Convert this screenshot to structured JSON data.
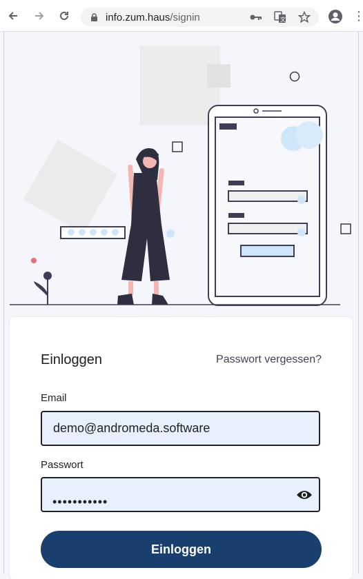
{
  "browser": {
    "url_host": "info.zum.haus",
    "url_path": "/signin",
    "back_icon": "arrow-left-icon",
    "forward_icon": "arrow-right-icon",
    "reload_icon": "reload-icon",
    "lock_icon": "lock-icon",
    "key_icon": "key-icon",
    "translate_icon": "translate-icon",
    "star_icon": "star-icon",
    "profile_icon": "profile-icon",
    "menu_icon": "kebab-menu-icon"
  },
  "login": {
    "title": "Einloggen",
    "forgot_label": "Passwort vergessen?",
    "email_label": "Email",
    "email_value": "demo@andromeda.software",
    "password_label": "Passwort",
    "password_mask": "•••••••••••",
    "show_password_icon": "eye-icon",
    "submit_label": "Einloggen"
  },
  "colors": {
    "page_background": "#f4f6fb",
    "input_background": "#e8f0fe",
    "button_primary": "#193f6e",
    "illustration_accent": "#cfe6fa"
  }
}
